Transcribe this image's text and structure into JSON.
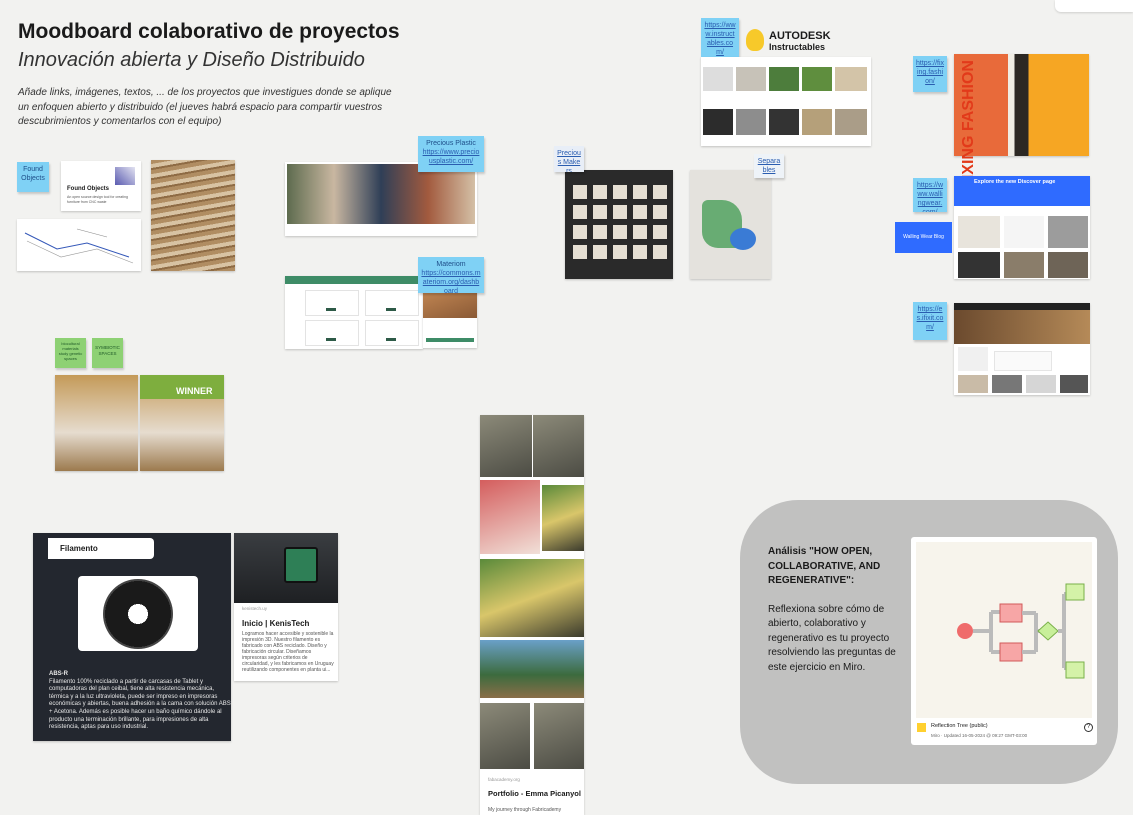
{
  "board": {
    "title": "Moodboard colaborativo de proyectos",
    "subtitle": "Innovación abierta y Diseño Distribuido",
    "intro": "Añade links, imágenes, textos, ... de los proyectos que investigues donde se aplique un enfoquen abierto y distribuido (el jueves habrá espacio para compartir vuestros descubrimientos y comentarlos con el equipo)"
  },
  "stickies": {
    "found_objects": "Found Objects",
    "precious_plastic_title": "Precious Plastic",
    "precious_plastic_link": "https://www.preciousplastic.com/",
    "materiom_title": "Materiom",
    "materiom_link": "https://commons.materiom.org/dashboard",
    "instructables_link": "https://www.instructables.com/",
    "fixing_link": "https://fixing.fashion/",
    "wallingwear_link": "https://www.wallingwear.com/",
    "ifixit_link": "https://es.ifixit.com/",
    "green1": "biocultural materials study genetic spaces",
    "green2": "SYMBIOTIC SPACES",
    "precious_makers": "Precious Makers",
    "separables": "Separables"
  },
  "cards": {
    "found_objects_title": "Found Objects",
    "found_objects_desc": "An open source design tool for creating furniture from CNC waste",
    "winner_label": "WINNER",
    "filamento_tag": "Filamento",
    "filamento_heading": "ABS-R",
    "filamento_body": "Filamento 100% reciclado a partir de carcasas de Tablet y computadoras del plan ceibal, tiene alta resistencia mecánica, térmica y a la luz ultravioleta, puede ser impreso en impresoras económicas y abiertas, buena adhesión a la cama con solución ABS + Acetona. Además es posible hacer un baño químico dándole al producto una terminación brillante, para impresiones de alta resistencia, aptas para uso industrial.",
    "kenis_title": "Inicio | KenisTech",
    "kenis_source": "kenistech.uy",
    "kenis_body": "Logramos hacer accesible y sostenible la impresión 3D. Nuestro filamento es fabricado con ABS reciclado. Diseño y fabricación circular. Diseñamos impresoras según criterios de circularidad, y les fabricamos en Uruguay reutilizando componentes en planta ui...",
    "portfolio_title": "Portfolio - Emma Picanyol",
    "portfolio_source": "fabacademy.org",
    "portfolio_desc": "My journey through Fabricademy",
    "instructables_brand_1": "AUTODESK",
    "instructables_brand_2": "Instructables",
    "fixing_text": "FIXING FASHION",
    "wallingwear_banner": "Explore the new Discover page",
    "blue_banner": "Walling Wear Blog"
  },
  "analysis": {
    "heading": "Análisis \"HOW OPEN, COLLABORATIVE, AND REGENERATIVE\":",
    "body": "Reflexiona sobre cómo de abierto, colaborativo y regenerativo es tu proyecto resolviendo las preguntas de este ejercicio en Miro.",
    "embed_title": "Reflection Tree (public)",
    "embed_meta": "Miro · Updated 16-05-2024 @ 09:27 GMT-03:00"
  },
  "colors": {
    "sticky_blue": "#7fd1f5",
    "sticky_green": "#8ed174",
    "analysis_bg": "#c1c1c0"
  }
}
